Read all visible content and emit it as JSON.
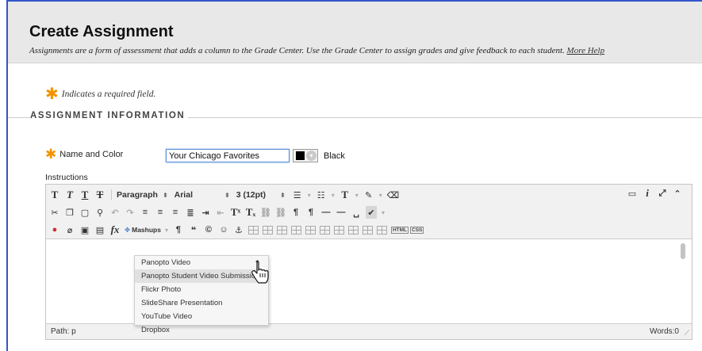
{
  "header": {
    "title": "Create Assignment",
    "description": "Assignments are a form of assessment that adds a column to the Grade Center. Use the Grade Center to assign grades and give feedback to each student.",
    "help_link": "More Help"
  },
  "required_note": "Indicates a required field.",
  "section_title": "ASSIGNMENT INFORMATION",
  "name_field": {
    "label": "Name and Color",
    "value": "Your Chicago Favorites",
    "color_name": "Black",
    "color_hex": "#000000"
  },
  "instructions_label": "Instructions",
  "toolbar": {
    "paragraph": "Paragraph",
    "font": "Arial",
    "size": "3 (12pt)",
    "mashups": "Mashups",
    "html_label": "HTML",
    "css_label": "CSS"
  },
  "mashups_menu": [
    "Panopto Video",
    "Panopto Student Video Submission",
    "Flickr Photo",
    "SlideShare Presentation",
    "YouTube Video",
    "Dropbox"
  ],
  "status": {
    "path": "Path: p",
    "words": "Words:0"
  },
  "colors": {
    "required_star": "#f29400",
    "frame_border": "#3355cc",
    "header_bg": "#e8e8e8"
  }
}
